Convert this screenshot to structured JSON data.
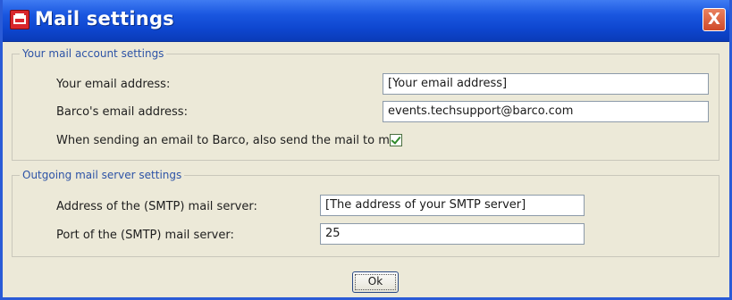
{
  "window": {
    "title": "Mail settings",
    "close_label": "X"
  },
  "account_group": {
    "legend": "Your mail account settings",
    "email_label": "Your email address:",
    "email_value": "[Your email address]",
    "barco_label": "Barco's email address:",
    "barco_value": "events.techsupport@barco.com",
    "copy_label": "When sending an email to Barco, also send the mail to me.",
    "copy_checked": true
  },
  "server_group": {
    "legend": "Outgoing mail server settings",
    "smtp_address_label": "Address of the (SMTP) mail server:",
    "smtp_address_value": "[The address of your SMTP server]",
    "smtp_port_label": "Port of the (SMTP) mail server:",
    "smtp_port_value": "25"
  },
  "footer": {
    "ok_label": "Ok"
  },
  "colors": {
    "titlebar": "#1a57e0",
    "dialog_bg": "#ece9d8",
    "legend_text": "#2d53a6"
  }
}
